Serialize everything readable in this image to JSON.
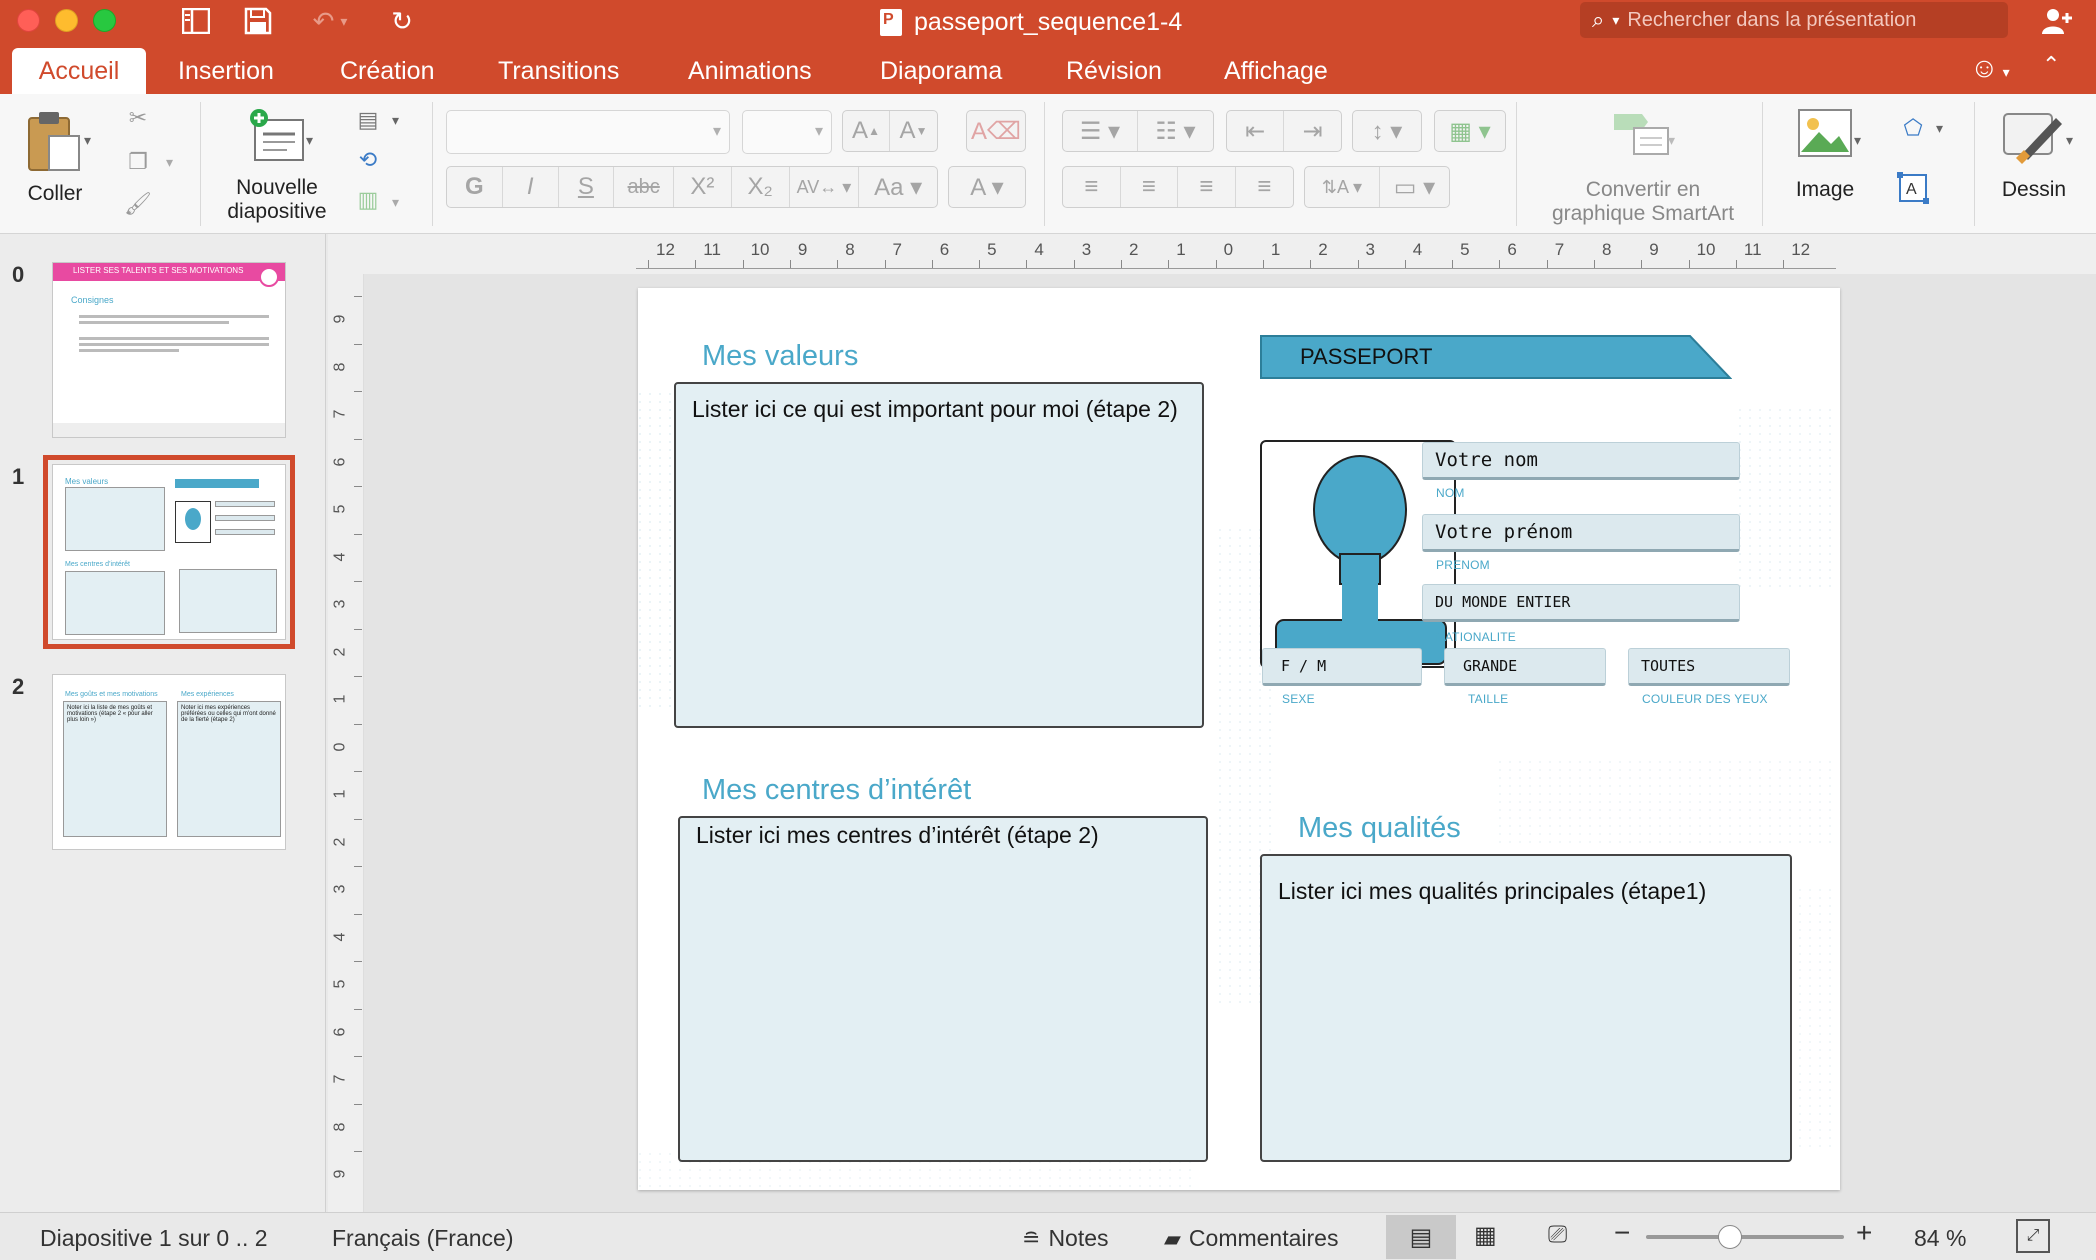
{
  "window": {
    "title": "passeport_sequence1-4",
    "search_placeholder": "Rechercher dans la présentation"
  },
  "tabs": [
    "Accueil",
    "Insertion",
    "Création",
    "Transitions",
    "Animations",
    "Diaporama",
    "Révision",
    "Affichage"
  ],
  "ribbon": {
    "paste_label": "Coller",
    "new_slide_label_1": "Nouvelle",
    "new_slide_label_2": "diapositive",
    "bold": "G",
    "italic": "I",
    "underline": "S",
    "strike": "abc",
    "superscript": "X²",
    "subscript": "X₂",
    "smartart_label_1": "Convertir en",
    "smartart_label_2": "graphique SmartArt",
    "image_label": "Image",
    "drawing_label": "Dessin"
  },
  "slides": [
    {
      "number": "0",
      "title": "LISTER SES TALENTS ET SES MOTIVATIONS",
      "subtitle": "Consignes"
    },
    {
      "number": "1",
      "selected": true
    },
    {
      "number": "2",
      "col1": "Mes goûts et mes motivations",
      "col2": "Mes expériences",
      "text1": "Noter ici la liste de mes goûts et motivations (étape 2 « pour aller plus loin »)",
      "text2": "Noter ici mes expériences préférées ou celles qui m'ont donné de la fierté (étape 2)"
    }
  ],
  "slide": {
    "values_heading": "Mes valeurs",
    "values_text": "Lister ici ce qui est important pour moi (étape 2)",
    "interests_heading": "Mes centres d’intérêt",
    "interests_text": "Lister ici mes centres d’intérêt (étape 2)",
    "qualities_heading": "Mes qualités",
    "qualities_text": "Lister ici mes qualités principales (étape1)",
    "passport_label": "PASSEPORT",
    "name_value": "Votre nom",
    "name_label": "NOM",
    "firstname_value": "Votre prénom",
    "firstname_label": "PRENOM",
    "nationality_value": "DU MONDE ENTIER",
    "nationality_label": "NATIONALITE",
    "sex_value": "F / M",
    "sex_label": "SEXE",
    "height_value": "GRANDE",
    "height_label": "TAILLE",
    "eyes_value": "TOUTES",
    "eyes_label": "COULEUR DES YEUX"
  },
  "ruler": {
    "h_ticks": [
      "12",
      "11",
      "10",
      "9",
      "8",
      "7",
      "6",
      "5",
      "4",
      "3",
      "2",
      "1",
      "0",
      "1",
      "2",
      "3",
      "4",
      "5",
      "6",
      "7",
      "8",
      "9",
      "10",
      "11",
      "12"
    ],
    "v_ticks": [
      "9",
      "8",
      "7",
      "6",
      "5",
      "4",
      "3",
      "2",
      "1",
      "0",
      "1",
      "2",
      "3",
      "4",
      "5",
      "6",
      "7",
      "8",
      "9"
    ]
  },
  "status": {
    "slide_info": "Diapositive 1 sur 0 .. 2",
    "language": "Français (France)",
    "notes": "Notes",
    "comments": "Commentaires",
    "zoom": "84 %"
  },
  "colors": {
    "accent": "#d04a2c",
    "slide_blue": "#4aa8c9",
    "box_fill": "#e3eff3"
  }
}
